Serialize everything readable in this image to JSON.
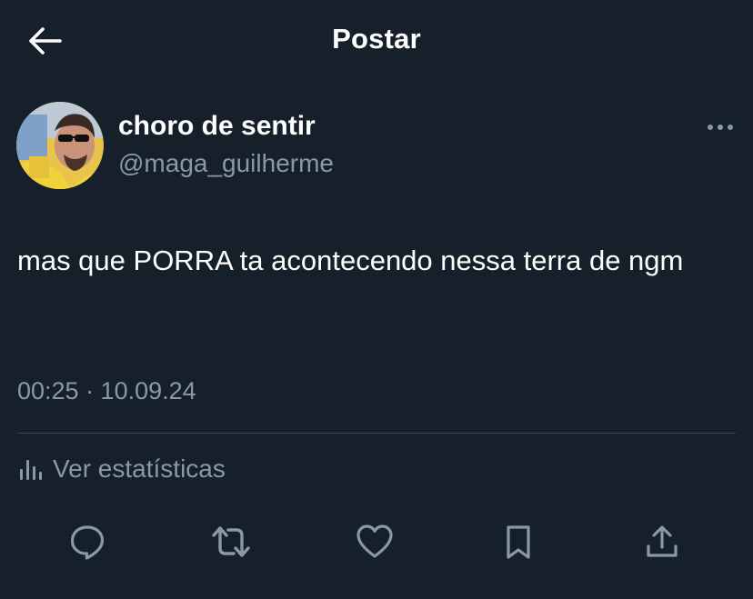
{
  "header": {
    "title": "Postar",
    "back_icon": "arrow-left-icon"
  },
  "author": {
    "display_name": "choro de sentir",
    "handle": "@maga_guilherme"
  },
  "tweet": {
    "text": "mas que PORRA ta acontecendo nessa terra de ngm",
    "timestamp": "00:25 · 10.09.24"
  },
  "stats": {
    "label": "Ver estatísticas",
    "icon": "bar-chart-icon"
  },
  "actions": [
    {
      "name": "reply",
      "icon": "speech-bubble-icon"
    },
    {
      "name": "repost",
      "icon": "retweet-icon"
    },
    {
      "name": "like",
      "icon": "heart-icon"
    },
    {
      "name": "bookmark",
      "icon": "bookmark-icon"
    },
    {
      "name": "share",
      "icon": "share-icon"
    }
  ],
  "colors": {
    "background": "#15202b",
    "text_primary": "#ffffff",
    "text_secondary": "#8b98a5",
    "divider": "#38444d"
  }
}
